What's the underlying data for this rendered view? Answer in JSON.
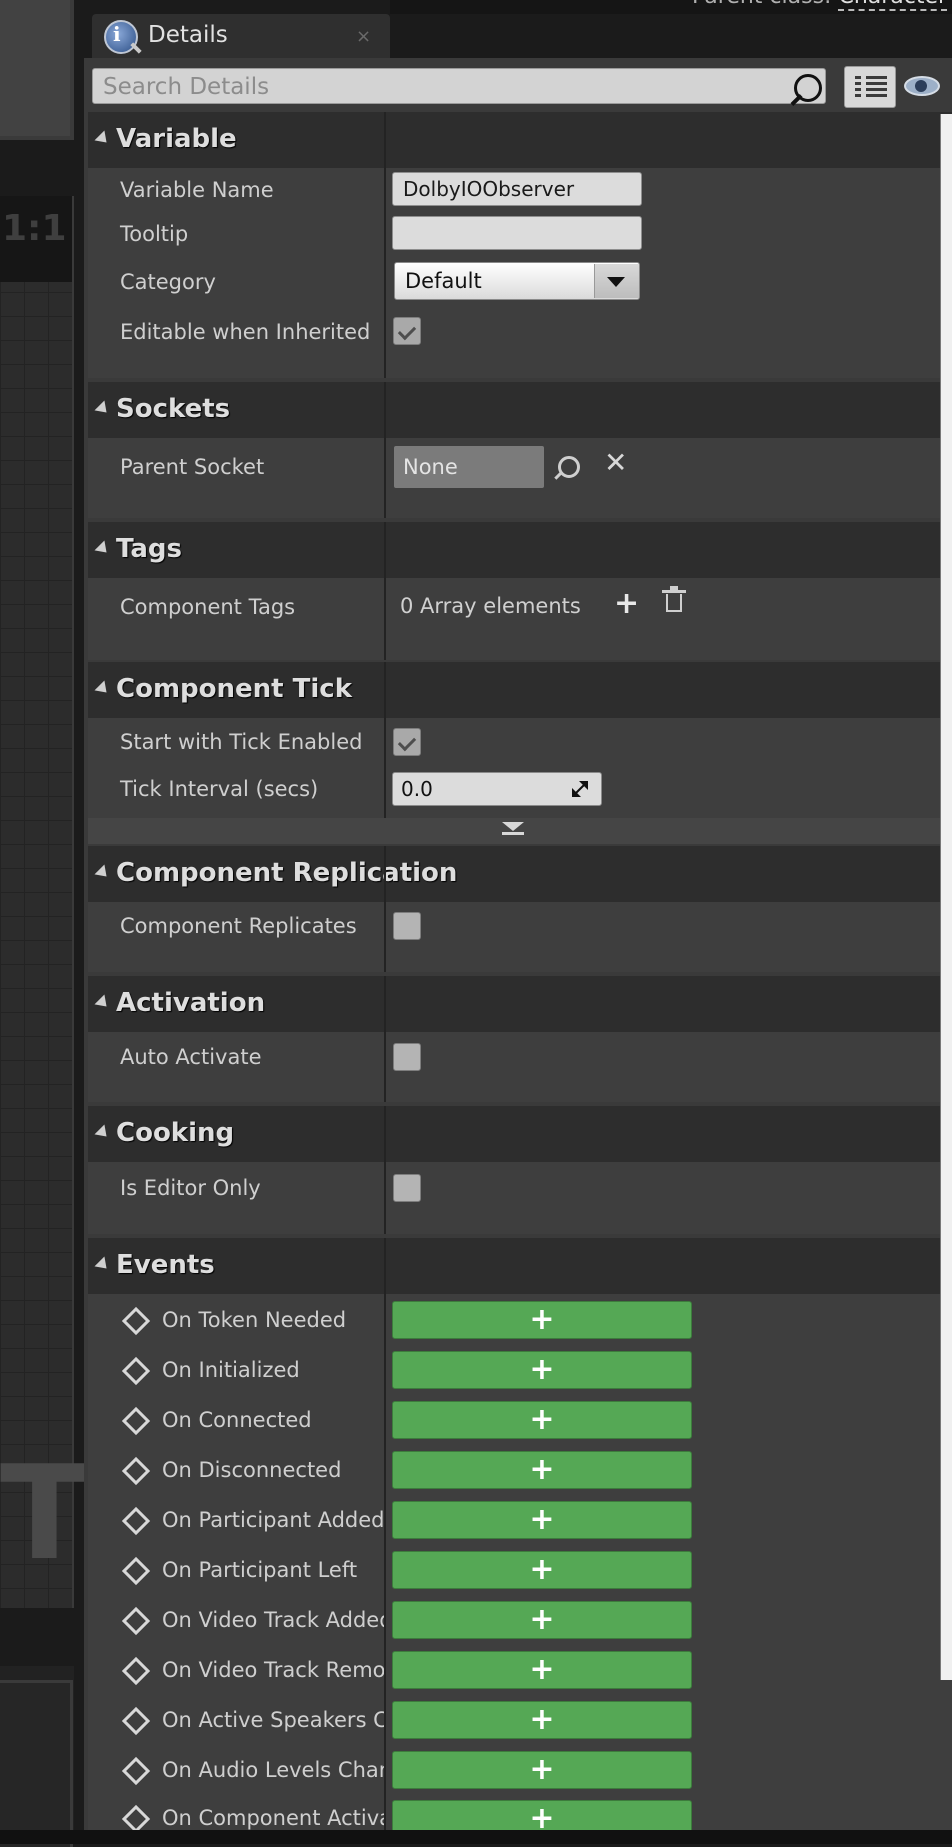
{
  "header": {
    "parent_class_label": "Parent class:",
    "parent_class_value": "Character"
  },
  "viewport": {
    "ratio": "1:1",
    "big_letter": "T"
  },
  "tab": {
    "title": "Details",
    "close": "×"
  },
  "search": {
    "placeholder": "Search Details"
  },
  "sections": {
    "variable": {
      "title": "Variable",
      "variable_name_label": "Variable Name",
      "variable_name_value": "DolbyIOObserver",
      "tooltip_label": "Tooltip",
      "tooltip_value": "",
      "category_label": "Category",
      "category_value": "Default",
      "editable_label": "Editable when Inherited",
      "editable_checked": true
    },
    "sockets": {
      "title": "Sockets",
      "parent_socket_label": "Parent Socket",
      "parent_socket_value": "None"
    },
    "tags": {
      "title": "Tags",
      "component_tags_label": "Component Tags",
      "component_tags_value": "0 Array elements"
    },
    "component_tick": {
      "title": "Component Tick",
      "start_tick_label": "Start with Tick Enabled",
      "start_tick_checked": true,
      "tick_interval_label": "Tick Interval (secs)",
      "tick_interval_value": "0.0"
    },
    "component_replication": {
      "title": "Component Replication",
      "replicates_label": "Component Replicates",
      "replicates_checked": false
    },
    "activation": {
      "title": "Activation",
      "auto_activate_label": "Auto Activate",
      "auto_activate_checked": false
    },
    "cooking": {
      "title": "Cooking",
      "editor_only_label": "Is Editor Only",
      "editor_only_checked": false
    },
    "events": {
      "title": "Events",
      "items": [
        "On Token Needed",
        "On Initialized",
        "On Connected",
        "On Disconnected",
        "On Participant Added",
        "On Participant Left",
        "On Video Track Added",
        "On Video Track Removed",
        "On Active Speakers Changed",
        "On Audio Levels Changed",
        "On Component Activated"
      ],
      "add_glyph": "+"
    }
  }
}
